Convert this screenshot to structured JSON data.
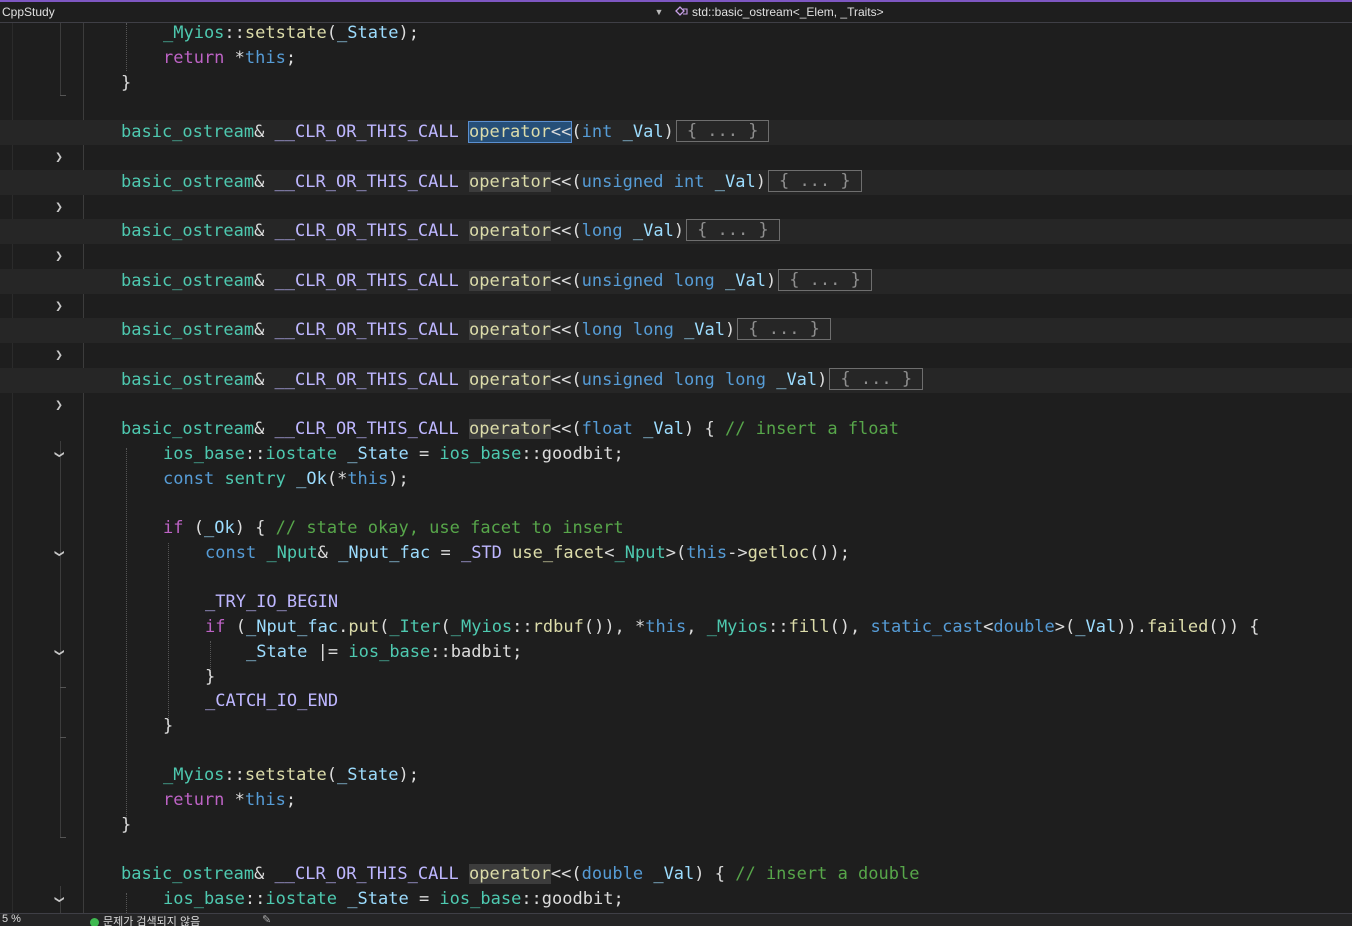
{
  "navbar": {
    "project": "CppStudy",
    "scope": "std::basic_ostream<_Elem, _Traits>",
    "scope_icon": "class-icon",
    "dropdown_icon": "chevron-down-icon"
  },
  "tokens": {
    "Myios": "_Myios",
    "setstate": "setstate",
    "State": "_State",
    "return": "return",
    "this": "this",
    "basic_ostream": "basic_ostream",
    "clr": "__CLR_OR_THIS_CALL",
    "operator": "operator",
    "lshift": "<<",
    "int": "int",
    "unsigned": "unsigned",
    "long": "long",
    "float": "float",
    "double": "double",
    "Val": "_Val",
    "ellipsis": "{ ... }",
    "ios_base": "ios_base",
    "iostate": "iostate",
    "goodbit": "goodbit",
    "badbit": "badbit",
    "const": "const",
    "sentry": "sentry",
    "Ok": "_Ok",
    "if": "if",
    "Nput": "_Nput",
    "Nput_fac": "_Nput_fac",
    "STD": "_STD",
    "use_facet": "use_facet",
    "getloc": "getloc",
    "TRY_IO_BEGIN": "_TRY_IO_BEGIN",
    "CATCH_IO_END": "_CATCH_IO_END",
    "put": "put",
    "Iter": "_Iter",
    "rdbuf": "rdbuf",
    "fill": "fill",
    "static_cast": "static_cast",
    "failed": "failed",
    "comment_float": "// insert a float",
    "comment_okay": "// state okay, use facet to insert",
    "comment_double": "// insert a double"
  },
  "statusbar": {
    "zoom": "5 %",
    "issues": "문제가 검색되지 않음"
  }
}
